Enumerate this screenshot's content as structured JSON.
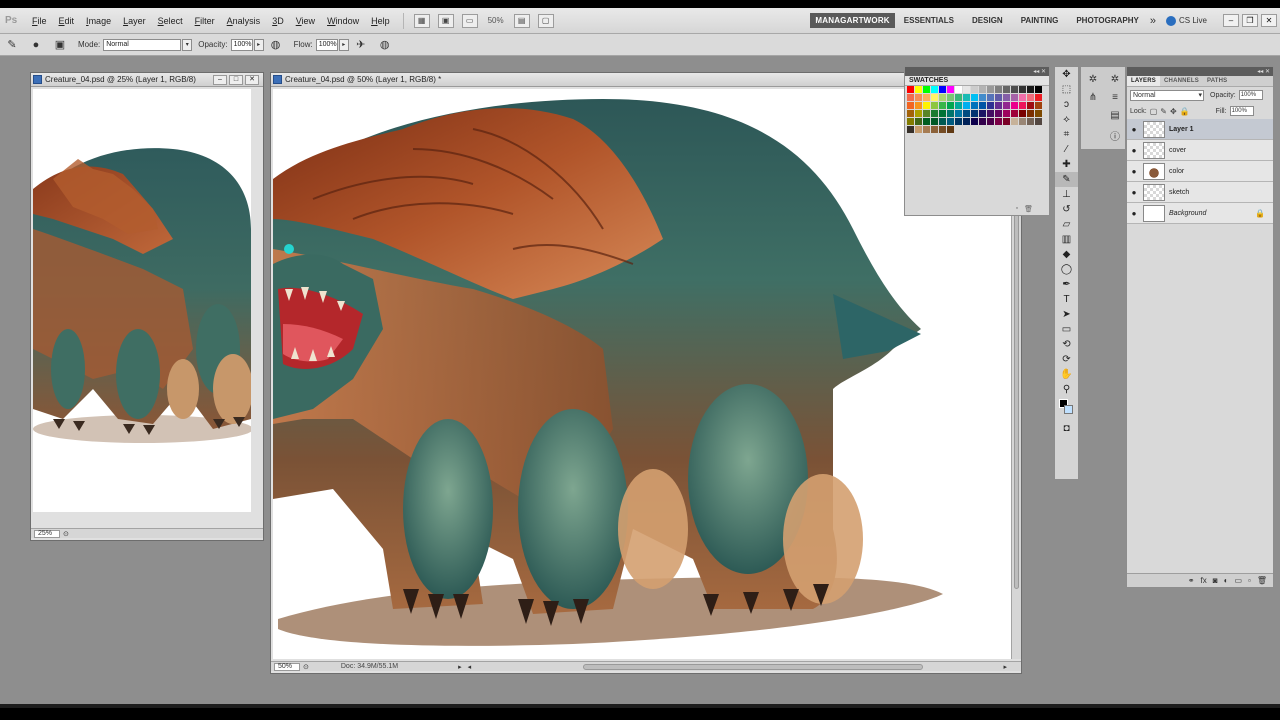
{
  "menubar": {
    "logo": "Ps",
    "items": [
      "File",
      "Edit",
      "Image",
      "Layer",
      "Select",
      "Filter",
      "Analysis",
      "3D",
      "View",
      "Window",
      "Help"
    ],
    "zoom": "50%",
    "workspaces": {
      "active": "MANAGARTWORK",
      "others": [
        "ESSENTIALS",
        "DESIGN",
        "PAINTING",
        "PHOTOGRAPHY"
      ]
    },
    "more": "»",
    "cslive": "CS Live"
  },
  "options": {
    "mode_label": "Mode:",
    "mode_value": "Normal",
    "opacity_label": "Opacity:",
    "opacity_value": "100%",
    "flow_label": "Flow:",
    "flow_value": "100%"
  },
  "doc_small": {
    "title": "Creature_04.psd @ 25% (Layer 1, RGB/8)",
    "zoom": "25%"
  },
  "doc_main": {
    "title": "Creature_04.psd @ 50% (Layer 1, RGB/8) *",
    "zoom": "50%",
    "doc_size": "Doc: 34.9M/55.1M"
  },
  "swatches": {
    "title": "SWATCHES",
    "colors": [
      "#ff0000",
      "#ffff00",
      "#00ff00",
      "#00ffff",
      "#0000ff",
      "#ff00ff",
      "#ffffff",
      "#e6e6e6",
      "#cccccc",
      "#b3b3b3",
      "#999999",
      "#808080",
      "#666666",
      "#4d4d4d",
      "#333333",
      "#1a1a1a",
      "#000000",
      "#f26c4f",
      "#f68e55",
      "#fbaf5c",
      "#fff467",
      "#acd372",
      "#7cc576",
      "#3bb878",
      "#1abbb4",
      "#00bff3",
      "#438ccb",
      "#5574b9",
      "#605ca8",
      "#855fa8",
      "#a763a8",
      "#f06ea9",
      "#f26d7d",
      "#ed1c24",
      "#f26522",
      "#f7941d",
      "#fff200",
      "#8dc63f",
      "#39b54a",
      "#00a651",
      "#00a99d",
      "#00aeef",
      "#0072bc",
      "#0054a6",
      "#2e3192",
      "#662d91",
      "#92278f",
      "#ec008c",
      "#ed145b",
      "#9e0b0f",
      "#a0410d",
      "#a3620a",
      "#aba000",
      "#598527",
      "#1a7b30",
      "#007236",
      "#00746b",
      "#0076a3",
      "#004b80",
      "#003471",
      "#1b1464",
      "#440e62",
      "#630460",
      "#9e005d",
      "#9e0039",
      "#790000",
      "#7b2e00",
      "#7d4900",
      "#827b00",
      "#406618",
      "#005e20",
      "#005826",
      "#005952",
      "#005b7f",
      "#003663",
      "#002157",
      "#0d004c",
      "#32004b",
      "#4b0049",
      "#7b0046",
      "#7a0026",
      "#c7b299",
      "#998675",
      "#736357",
      "#534741",
      "#37302a",
      "#c69c6d",
      "#a67c52",
      "#8c6239",
      "#754c24",
      "#603913"
    ]
  },
  "layers_panel": {
    "tabs": [
      "LAYERS",
      "CHANNELS",
      "PATHS"
    ],
    "blend": "Normal",
    "opacity_label": "Opacity:",
    "opacity_value": "100%",
    "lock_label": "Lock:",
    "fill_label": "Fill:",
    "fill_value": "100%",
    "layers": [
      {
        "name": "Layer 1",
        "selected": true
      },
      {
        "name": "cover"
      },
      {
        "name": "color"
      },
      {
        "name": "sketch"
      },
      {
        "name": "Background"
      }
    ]
  }
}
